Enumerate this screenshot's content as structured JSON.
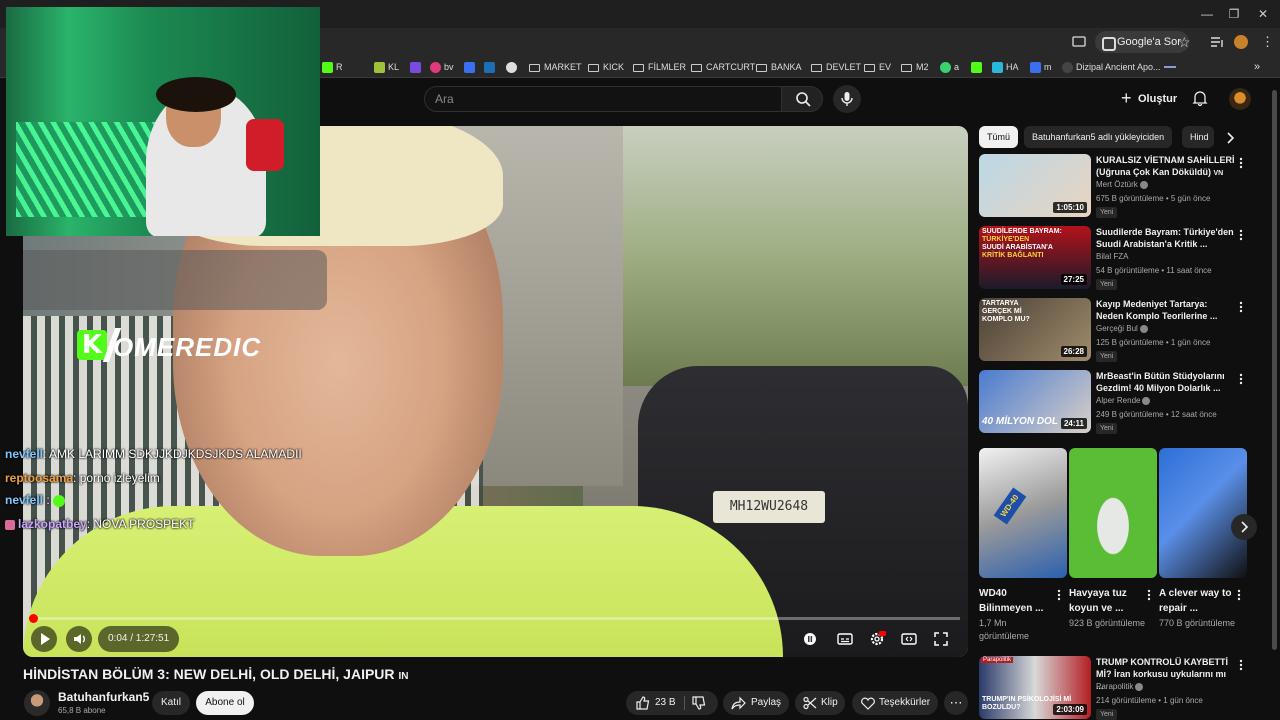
{
  "browser": {
    "google_pill": "Google'a Sor",
    "bookmarks": [
      "R",
      "KL",
      "bv",
      "MARKET",
      "KICK",
      "FİLMLER",
      "CARTCURT",
      "BANKA",
      "DEVLET",
      "EV",
      "M2",
      "a",
      "HA",
      "m",
      "Dizipal Ancient Apo..."
    ]
  },
  "masthead": {
    "search_placeholder": "Ara",
    "create_label": "Oluştur"
  },
  "overlay": {
    "streamer_logo": "OMEREDIC",
    "chat": [
      {
        "user": "nevfell",
        "text": ": AMK LARIMM SDKJJKDJKDSJKDS ALAMADII",
        "color": "#7ec8ff"
      },
      {
        "user": "reptoosama",
        "text": ": porno izleyelim",
        "color": "#f0a040"
      },
      {
        "user": "nevfell",
        "text": " :",
        "color": "#7ec8ff"
      },
      {
        "user": "lazkopatbey",
        "text": ": NOVA PROSPEKT",
        "color": "#c9a6ff"
      }
    ]
  },
  "player": {
    "plate": "MH12WU2648",
    "time": "0:04 / 1:27:51",
    "progress_fraction": 0.0008
  },
  "video": {
    "title": "HİNDİSTAN BÖLÜM 3: NEW DELHİ, OLD DELHİ, JAIPUR",
    "title_suffix": "IN",
    "channel": "Batuhanfurkan5",
    "subs": "65,8 B abone",
    "join": "Katıl",
    "subscribe": "Abone ol",
    "likes": "23 B",
    "share": "Paylaş",
    "clip": "Klip",
    "thanks": "Teşekkürler"
  },
  "chips": [
    "Tümü",
    "Batuhanfurkan5 adlı yükleyiciden",
    "Hind"
  ],
  "recommendations": [
    {
      "title": "KURALSIZ VİETNAM SAHİLLERİ (Uğruna Çok Kan Döküldü)",
      "title_suffix": "VN",
      "channel": "Mert Öztürk",
      "verified": true,
      "meta": "675 B görüntüleme • 5 gün önce",
      "badge": "Yeni",
      "duration": "1:05:10",
      "thumb": [
        "#bcd8e6",
        "#e8d4c0"
      ]
    },
    {
      "title": "Suudilerde Bayram: Türkiye'den Suudi Arabistan'a Kritik ...",
      "title_suffix": "",
      "channel": "Bilal FZA",
      "verified": false,
      "meta": "54 B görüntüleme • 11 saat önce",
      "badge": "Yeni",
      "duration": "27:25",
      "thumb": [
        "#b3121a",
        "#1b1b2a"
      ]
    },
    {
      "title": "Kayıp Medeniyet Tartarya: Neden Komplo Teorilerine ...",
      "title_suffix": "",
      "channel": "Gerçeği Bul",
      "verified": true,
      "meta": "125 B görüntüleme • 1 gün önce",
      "badge": "Yeni",
      "duration": "26:28",
      "thumb": [
        "#4a4036",
        "#a08c6c"
      ]
    },
    {
      "title": "MrBeast'in Bütün Stüdyolarını Gezdim! 40 Milyon Dolarlık ...",
      "title_suffix": "",
      "channel": "Alper Rende",
      "verified": true,
      "meta": "249 B görüntüleme • 12 saat önce",
      "badge": "Yeni",
      "duration": "24:11",
      "thumb": [
        "#4a7bd0",
        "#d8d0c8"
      ]
    },
    {
      "title": "TRUMP KONTROLÜ KAYBETTİ Mİ? İran korkusu uykularını mı ...",
      "title_suffix": "",
      "channel": "Parapolitik",
      "verified": true,
      "meta": "214 görüntüleme • 1 gün önce",
      "badge": "Yeni",
      "duration": "2:03:09",
      "thumb": [
        "#2a3a6a",
        "#b31e24"
      ]
    }
  ],
  "thumb_text": {
    "r2": [
      "SUUDİLERDE BAYRAM:",
      "TÜRKİYE'DEN",
      "SUUDİ ARABİSTAN'A",
      "KRİTİK BAĞLANTI"
    ],
    "r3": [
      "TARTARYA",
      "GERÇEK Mİ",
      "KOMPLO MU?"
    ],
    "r4": "40 MİLYON DOL",
    "r5": [
      "TRUMP'IN PSİKOLOJİSİ Mİ",
      "BOZULDU?"
    ],
    "r5_top": "Parapolitik"
  },
  "shorts": [
    {
      "title": "WD40 Bilinmeyen ...",
      "views": "1,7 Mn görüntüleme",
      "thumb": [
        "#f2f2f2",
        "#2b60b0"
      ]
    },
    {
      "title": "Havyaya tuz koyun ve ...",
      "views": "923 B görüntüleme",
      "thumb": [
        "#5bbd35",
        "#cfd4d0"
      ]
    },
    {
      "title": "A clever way to repair ...",
      "views": "770 B görüntüleme",
      "thumb": [
        "#2c6fd6",
        "#101010"
      ]
    }
  ],
  "short_thumb_text": {
    "wd40": "WD-40"
  },
  "colors": {
    "accent": "#ff0000",
    "kick": "#53fc18"
  }
}
